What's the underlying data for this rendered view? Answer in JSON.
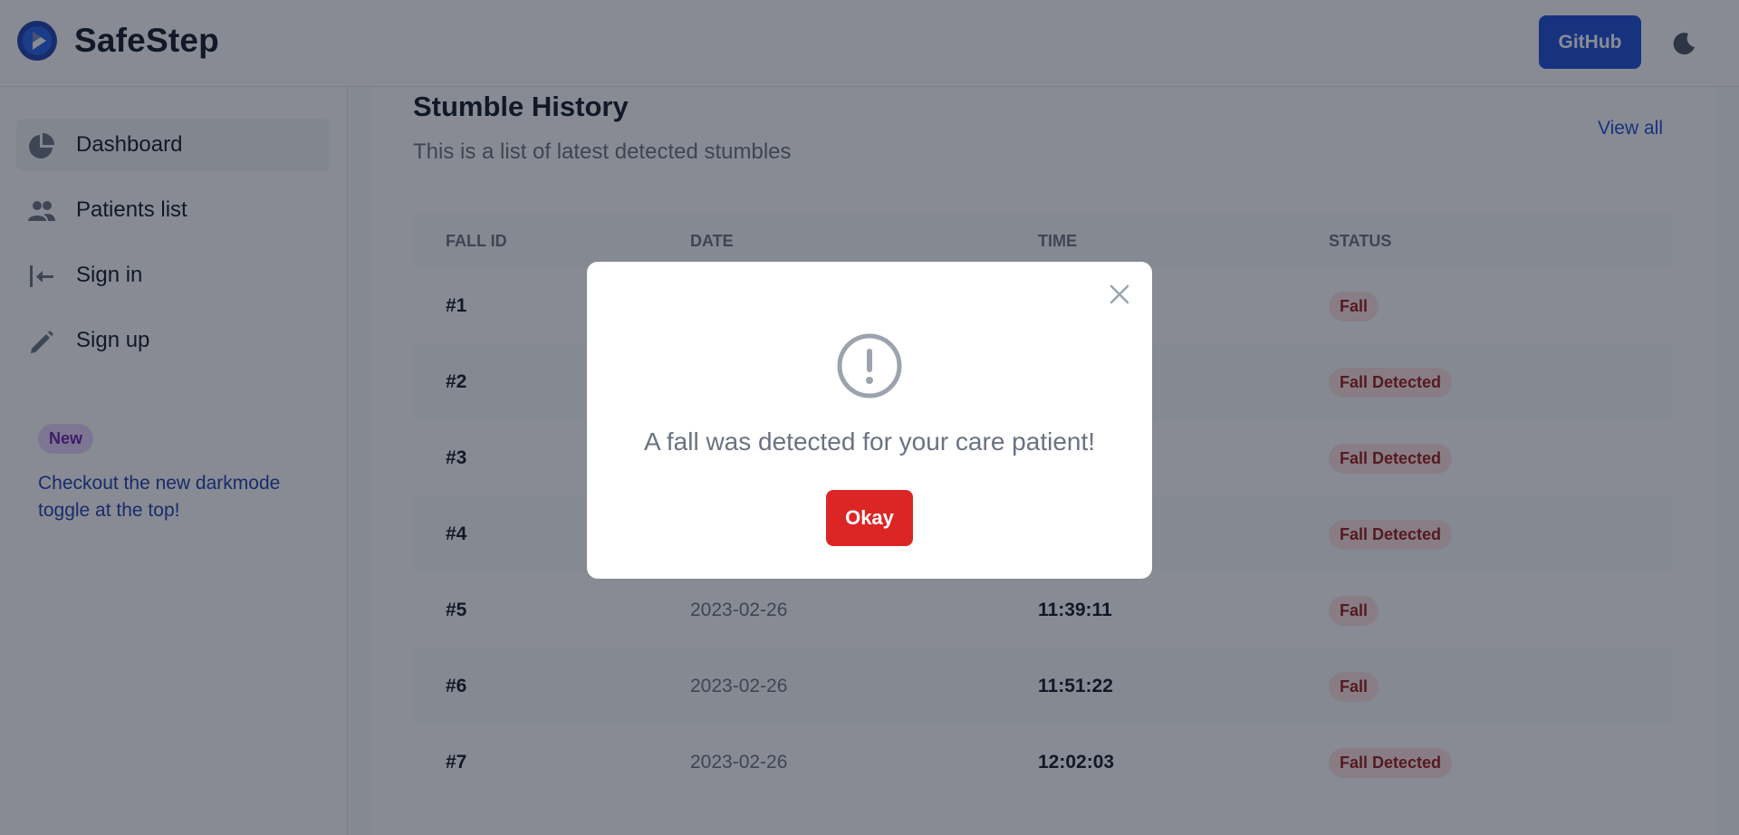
{
  "header": {
    "brand": "SafeStep",
    "github_label": "GitHub"
  },
  "sidebar": {
    "items": [
      {
        "label": "Dashboard",
        "icon": "pie-chart-icon"
      },
      {
        "label": "Patients list",
        "icon": "users-icon"
      },
      {
        "label": "Sign in",
        "icon": "sign-in-icon"
      },
      {
        "label": "Sign up",
        "icon": "pencil-icon"
      }
    ],
    "promo": {
      "badge": "New",
      "text": "Checkout the new darkmode toggle at the top!"
    }
  },
  "main": {
    "title": "Stumble History",
    "subtitle": "This is a list of latest detected stumbles",
    "view_all": "View all",
    "columns": [
      "FALL ID",
      "DATE",
      "TIME",
      "STATUS"
    ],
    "rows": [
      {
        "id": "#1",
        "date": "",
        "time": "",
        "status": "Fall"
      },
      {
        "id": "#2",
        "date": "",
        "time": "",
        "status": "Fall Detected"
      },
      {
        "id": "#3",
        "date": "",
        "time": "",
        "status": "Fall Detected"
      },
      {
        "id": "#4",
        "date": "",
        "time": "",
        "status": "Fall Detected"
      },
      {
        "id": "#5",
        "date": "2023-02-26",
        "time": "11:39:11",
        "status": "Fall"
      },
      {
        "id": "#6",
        "date": "2023-02-26",
        "time": "11:51:22",
        "status": "Fall"
      },
      {
        "id": "#7",
        "date": "2023-02-26",
        "time": "12:02:03",
        "status": "Fall Detected"
      }
    ]
  },
  "modal": {
    "message": "A fall was detected for your care patient!",
    "okay_label": "Okay"
  },
  "colors": {
    "primary": "#1d4ed8",
    "danger": "#dc2626",
    "overlay": "rgba(17,24,39,0.5)"
  }
}
